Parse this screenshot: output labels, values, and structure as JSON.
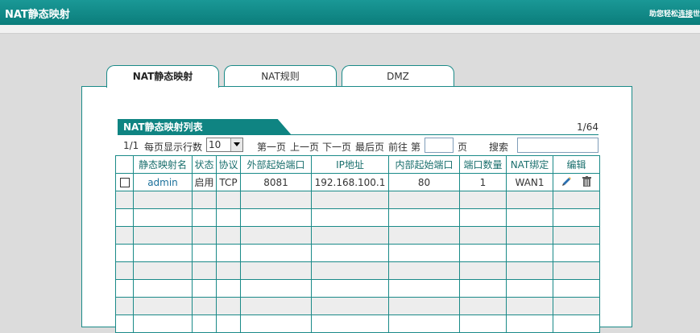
{
  "header": {
    "title": "NAT静态映射",
    "helper": "助您轻松",
    "helper_link": "连接",
    "helper_tail": "世"
  },
  "tabs": [
    {
      "label": "NAT静态映射",
      "active": true
    },
    {
      "label": "NAT规则",
      "active": false
    },
    {
      "label": "DMZ",
      "active": false
    }
  ],
  "list": {
    "title": "NAT静态映射列表",
    "page_count": "1/64"
  },
  "pager": {
    "current": "1/1",
    "per_page_label": "每页显示行数",
    "per_page_value": "10",
    "first": "第一页",
    "prev": "上一页",
    "next": "下一页",
    "last": "最后页",
    "goto": "前往",
    "di": "第",
    "ye": "页",
    "search_label": "搜索",
    "goto_value": "",
    "search_value": ""
  },
  "table": {
    "headers": [
      "",
      "静态映射名",
      "状态",
      "协议",
      "外部起始端口",
      "IP地址",
      "内部起始端口",
      "端口数量",
      "NAT绑定",
      "编辑"
    ],
    "rows": [
      {
        "name": "admin",
        "status": "启用",
        "protocol": "TCP",
        "ext_port": "8081",
        "ip": "192.168.100.1",
        "int_port": "80",
        "count": "1",
        "bind": "WAN1"
      }
    ],
    "empty_rows": 8
  },
  "icons": {
    "edit": "pencil-icon",
    "delete": "trash-icon"
  },
  "colors": {
    "accent": "#0f8482",
    "border": "#1a8a88",
    "header_text": "#1a6f6d"
  }
}
